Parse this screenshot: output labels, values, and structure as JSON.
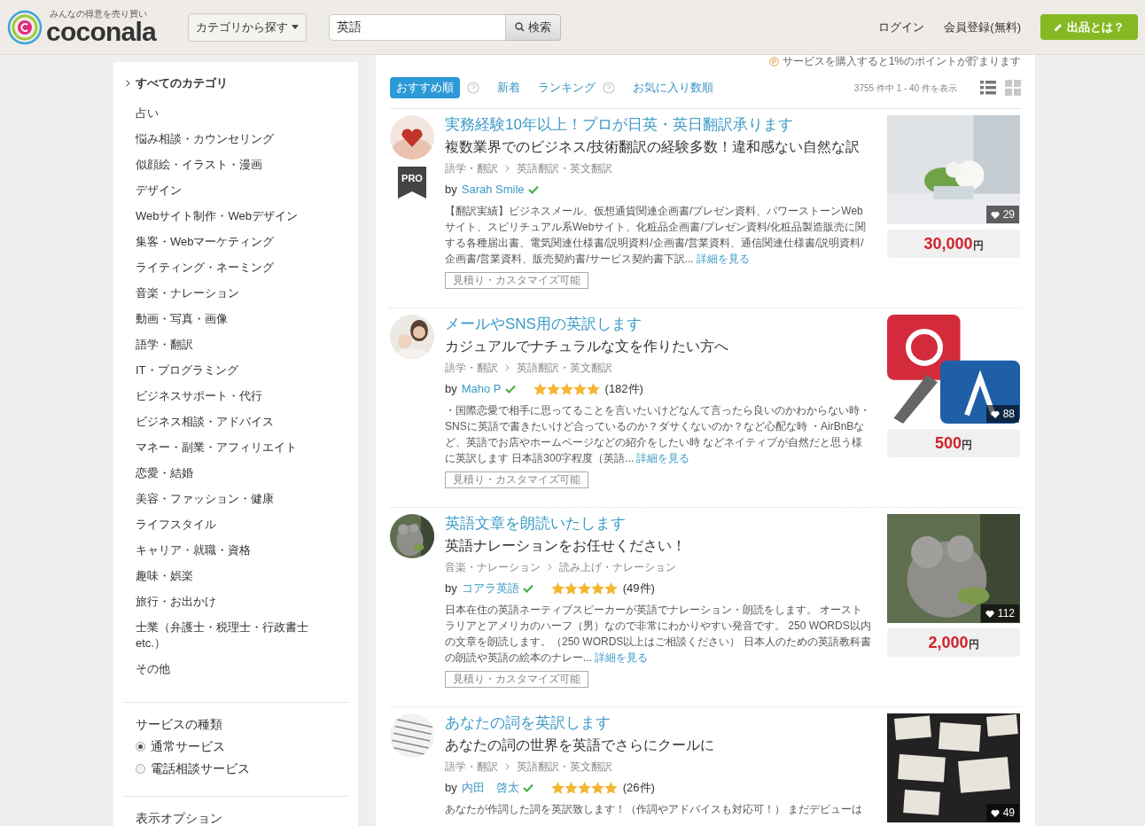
{
  "header": {
    "logo_tagline": "みんなの得意を売り買い",
    "logo_text": "coconala",
    "category_button": "カテゴリから探す",
    "search": {
      "value": "英語",
      "button": "検索"
    },
    "links": [
      "ログイン",
      "会員登録(無料)"
    ],
    "cta_button": "出品とは？"
  },
  "sidebar": {
    "all_categories": "すべてのカテゴリ",
    "categories": [
      "占い",
      "悩み相談・カウンセリング",
      "似顔絵・イラスト・漫画",
      "デザイン",
      "Webサイト制作・Webデザイン",
      "集客・Webマーケティング",
      "ライティング・ネーミング",
      "音楽・ナレーション",
      "動画・写真・画像",
      "語学・翻訳",
      "IT・プログラミング",
      "ビジネスサポート・代行",
      "ビジネス相談・アドバイス",
      "マネー・副業・アフィリエイト",
      "恋愛・結婚",
      "美容・ファッション・健康",
      "ライフスタイル",
      "キャリア・就職・資格",
      "趣味・娯楽",
      "旅行・お出かけ",
      "士業（弁護士・税理士・行政書士etc.）",
      "その他"
    ],
    "service_type": {
      "title": "サービスの種類",
      "options": [
        {
          "label": "通常サービス",
          "selected": true
        },
        {
          "label": "電話相談サービス",
          "selected": false
        }
      ]
    },
    "display_options_title": "表示オプション"
  },
  "points_notice": "サービスを購入すると1%のポイントが貯まります",
  "sort_tabs": [
    {
      "label": "おすすめ順",
      "selected": true,
      "help": true
    },
    {
      "label": "新着",
      "selected": false,
      "help": false
    },
    {
      "label": "ランキング",
      "selected": false,
      "help": true
    },
    {
      "label": "お気に入り数順",
      "selected": false,
      "help": false
    }
  ],
  "result_count": "3755 件中 1 - 40 件を表示",
  "view_modes": [
    {
      "kind": "list",
      "selected": true
    },
    {
      "kind": "grid",
      "selected": false
    }
  ],
  "listings": [
    {
      "title": "実務経験10年以上！プロが日英・英日翻訳承ります",
      "subtitle": "複数業界でのビジネス/技術翻訳の経験多数！違和感ない自然な訳",
      "breadcrumb": [
        "語学・翻訳",
        "英語翻訳・英文翻訳"
      ],
      "seller": "Sarah Smile",
      "pro": true,
      "description": "【翻訳実績】ビジネスメール、仮想通貨関連企画書/プレゼン資料、パワーストーンWebサイト、スピリチュアル系Webサイト、化粧品企画書/プレゼン資料/化粧品製造販売に関する各種届出書、電気関連仕様書/説明資料/企画書/営業資料、通信関連仕様書/説明資料/企画書/営業資料、販売契約書/サービス契約書下訳...",
      "more": "詳細を見る",
      "tag": "見積り・カスタマイズ可能",
      "favorites": "29",
      "price": "30,000",
      "currency": "円",
      "by": "by",
      "pro_label": "PRO"
    },
    {
      "title": "メールやSNS用の英訳します",
      "subtitle": "カジュアルでナチュラルな文を作りたい方へ",
      "breadcrumb": [
        "語学・翻訳",
        "英語翻訳・英文翻訳"
      ],
      "seller": "Maho P",
      "pro": false,
      "stars": 5,
      "reviews": "(182件)",
      "description": "・国際恋愛で相手に思ってることを言いたいけどなんて言ったら良いのかわからない時・SNSに英語で書きたいけど合っているのか？ダサくないのか？など心配な時 ・AirBnBなど、英語でお店やホームページなどの紹介をしたい時 などネイティブが自然だと思う様に英訳します 日本語300字程度（英語...",
      "more": "詳細を見る",
      "tag": "見積り・カスタマイズ可能",
      "favorites": "88",
      "price": "500",
      "currency": "円",
      "by": "by"
    },
    {
      "title": "英語文章を朗読いたします",
      "subtitle": "英語ナレーションをお任せください！",
      "breadcrumb": [
        "音楽・ナレーション",
        "読み上げ・ナレーション"
      ],
      "seller": "コアラ英語",
      "pro": false,
      "stars": 5,
      "reviews": "(49件)",
      "description": "日本在住の英語ネーティブスピーカーが英語でナレーション・朗読をします。 オーストラリアとアメリカのハーフ（男）なので非常にわかりやすい発音です。 250 WORDS以内の文章を朗読します。（250 WORDS以上はご相談ください） 日本人のための英語教科書の朗読や英語の絵本のナレー...",
      "more": "詳細を見る",
      "tag": "見積り・カスタマイズ可能",
      "favorites": "112",
      "price": "2,000",
      "currency": "円",
      "by": "by"
    },
    {
      "title": "あなたの詞を英訳します",
      "subtitle": "あなたの詞の世界を英語でさらにクールに",
      "breadcrumb": [
        "語学・翻訳",
        "英語翻訳・英文翻訳"
      ],
      "seller": "内田　啓太",
      "pro": false,
      "stars": 5,
      "reviews": "(26件)",
      "description": "あなたが作詞した詞を英訳致します！（作詞やアドバイスも対応可！） まだデビューは",
      "favorites": "49",
      "by": "by"
    }
  ]
}
